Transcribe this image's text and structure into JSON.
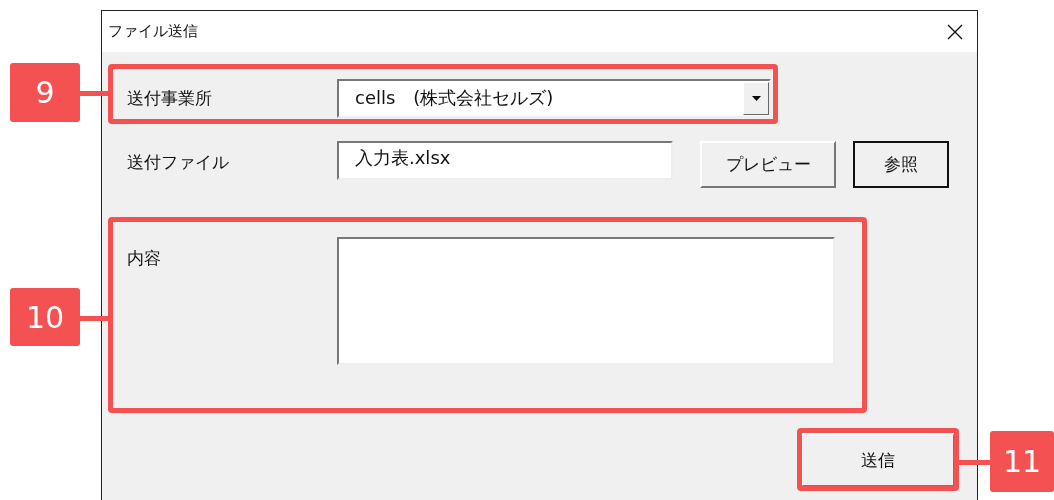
{
  "window": {
    "title": "ファイル送信"
  },
  "fields": [
    {
      "kind": "dropdown",
      "label": "送付事業所",
      "value": "cells　(株式会社セルズ)"
    },
    {
      "kind": "text",
      "label": "送付ファイル",
      "value": "入力表.xlsx",
      "buttons": [
        {
          "label": "プレビュー",
          "default": false
        },
        {
          "label": "参照",
          "default": true
        }
      ]
    },
    {
      "kind": "textarea",
      "label": "内容"
    }
  ],
  "send_button": {
    "label": "送信"
  },
  "callouts": [
    {
      "label": "9"
    },
    {
      "label": "10"
    },
    {
      "label": "11"
    }
  ]
}
